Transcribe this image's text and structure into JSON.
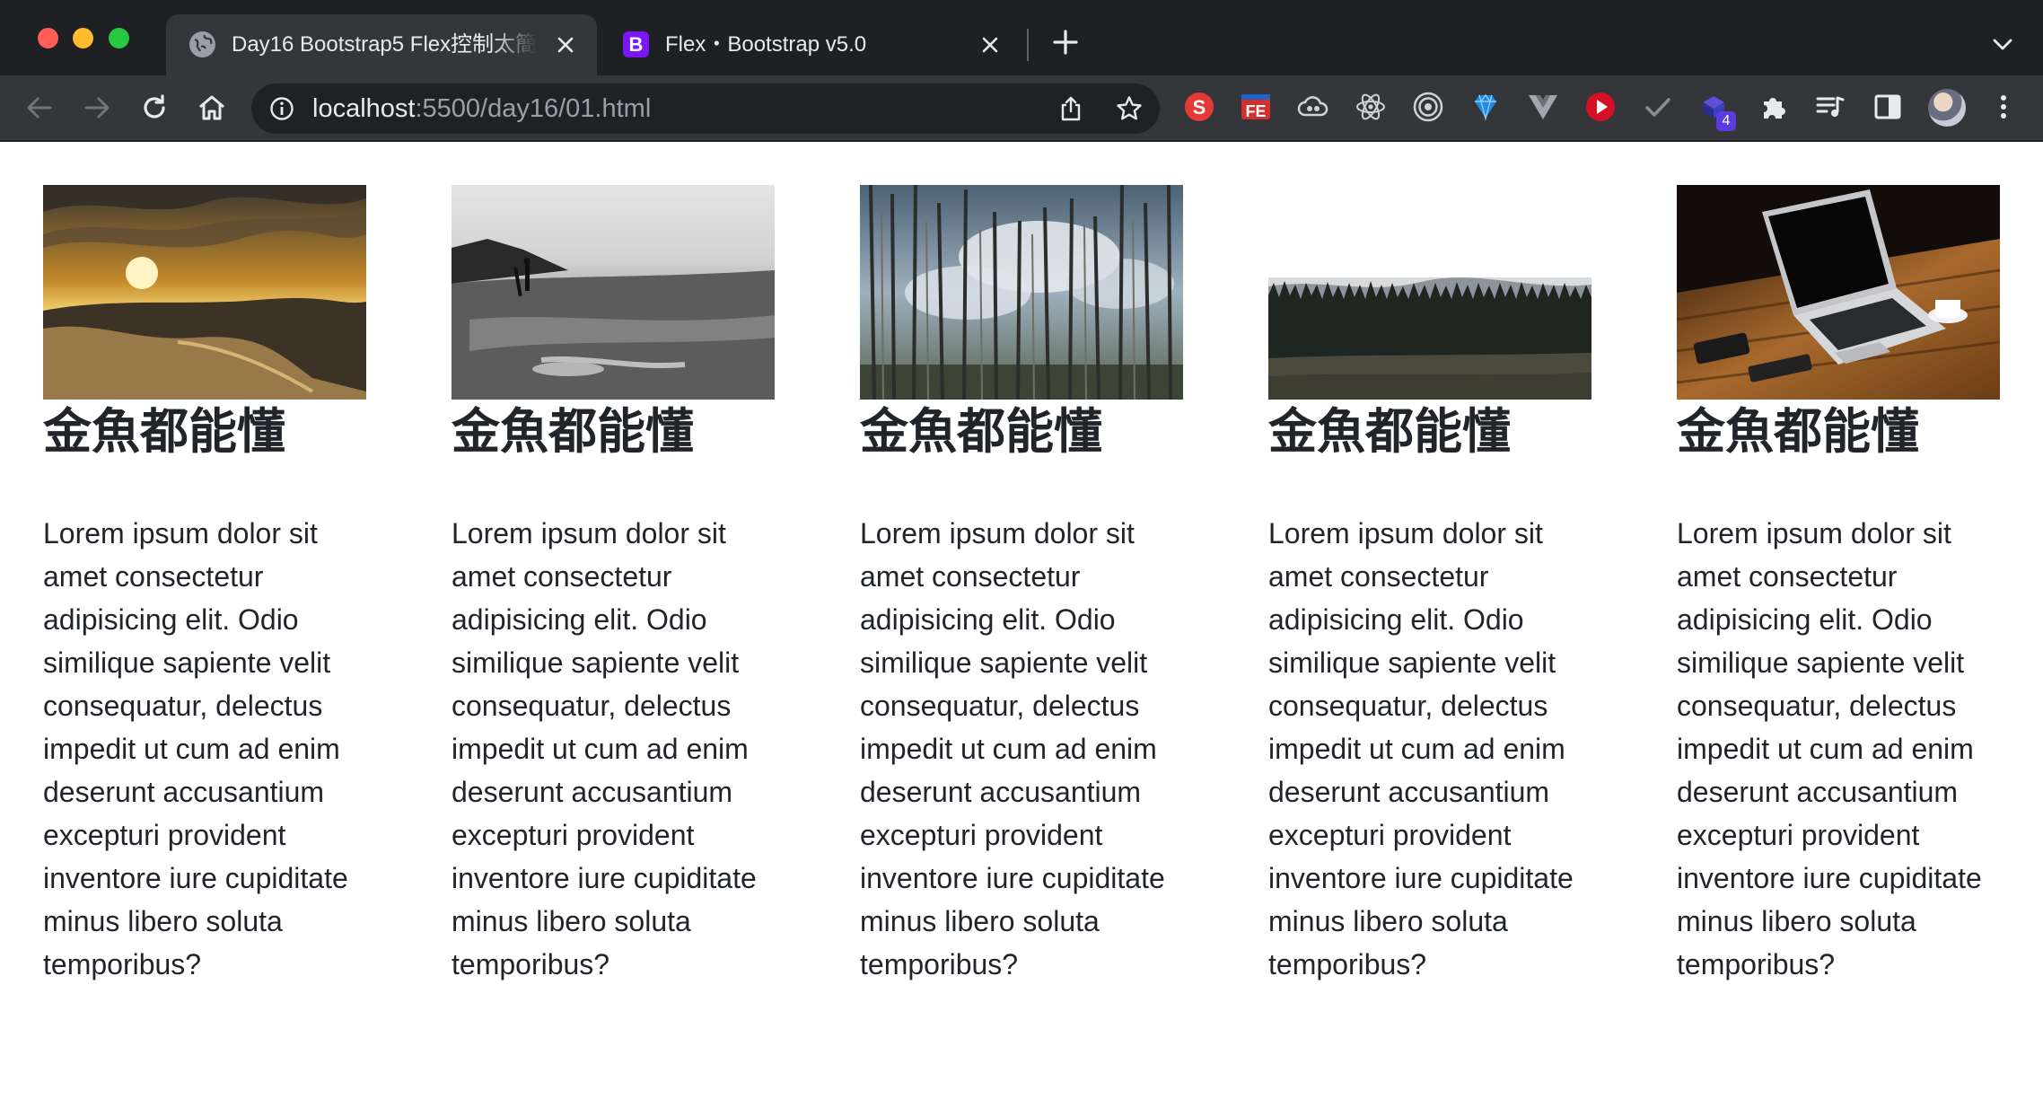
{
  "browser": {
    "tabs": [
      {
        "title": "Day16 Bootstrap5 Flex控制太簡",
        "favicon": "globe-icon",
        "active": true
      },
      {
        "title": "Flex・Bootstrap v5.0",
        "favicon": "bootstrap-logo-icon",
        "favicon_text": "B",
        "active": false
      }
    ],
    "address": {
      "host": "localhost",
      "rest": ":5500/day16/01.html"
    },
    "extensions": [
      "s-extension-icon",
      "fe-extension-icon",
      "cloud-extension-icon",
      "react-devtools-icon",
      "target-extension-icon",
      "gem-extension-icon",
      "vue-devtools-icon",
      "play-extension-icon",
      "check-extension-icon",
      "cube-extension-icon",
      "puzzle-extensions-icon",
      "media-controls-icon",
      "side-panel-icon"
    ],
    "extension_labels": {
      "s": "S",
      "fe": "FE"
    },
    "badge_count": "4",
    "colors": {
      "chrome_dark": "#1f2023",
      "toolbar": "#35363a",
      "omnibox": "#202124",
      "bootstrap": "#7b17f7"
    }
  },
  "cards": [
    {
      "photo": "sunset-beach-photo",
      "heading": "金魚都能懂",
      "lines": [
        "Lorem ipsum dolor sit",
        "amet consectetur",
        "adipisicing elit. Odio",
        "similique sapiente velit",
        "consequatur, delectus",
        "impedit ut cum ad enim",
        "deserunt accusantium",
        "excepturi provident",
        "inventore iure cupiditate",
        "minus libero soluta",
        "temporibus?"
      ]
    },
    {
      "photo": "surfer-beach-bw-photo",
      "heading": "金魚都能懂",
      "lines": [
        "Lorem ipsum dolor sit",
        "amet consectetur",
        "adipisicing elit. Odio",
        "similique sapiente velit",
        "consequatur, delectus",
        "impedit ut cum ad enim",
        "deserunt accusantium",
        "excepturi provident",
        "inventore iure cupiditate",
        "minus libero soluta",
        "temporibus?"
      ]
    },
    {
      "photo": "forest-sky-photo",
      "heading": "金魚都能懂",
      "lines": [
        "Lorem ipsum dolor sit",
        "amet consectetur",
        "adipisicing elit. Odio",
        "similique sapiente velit",
        "consequatur, delectus",
        "impedit ut cum ad enim",
        "deserunt accusantium",
        "excepturi provident",
        "inventore iure cupiditate",
        "minus libero soluta",
        "temporibus?"
      ]
    },
    {
      "photo": "forest-field-photo",
      "heading": "金魚都能懂",
      "lines": [
        "Lorem ipsum dolor sit",
        "amet consectetur",
        "adipisicing elit. Odio",
        "similique sapiente velit",
        "consequatur, delectus",
        "impedit ut cum ad enim",
        "deserunt accusantium",
        "excepturi provident",
        "inventore iure cupiditate",
        "minus libero soluta",
        "temporibus?"
      ]
    },
    {
      "photo": "laptop-desk-photo",
      "heading": "金魚都能懂",
      "lines": [
        "Lorem ipsum dolor sit",
        "amet consectetur",
        "adipisicing elit. Odio",
        "similique sapiente velit",
        "consequatur, delectus",
        "impedit ut cum ad enim",
        "deserunt accusantium",
        "excepturi provident",
        "inventore iure cupiditate",
        "minus libero soluta",
        "temporibus?"
      ]
    }
  ]
}
